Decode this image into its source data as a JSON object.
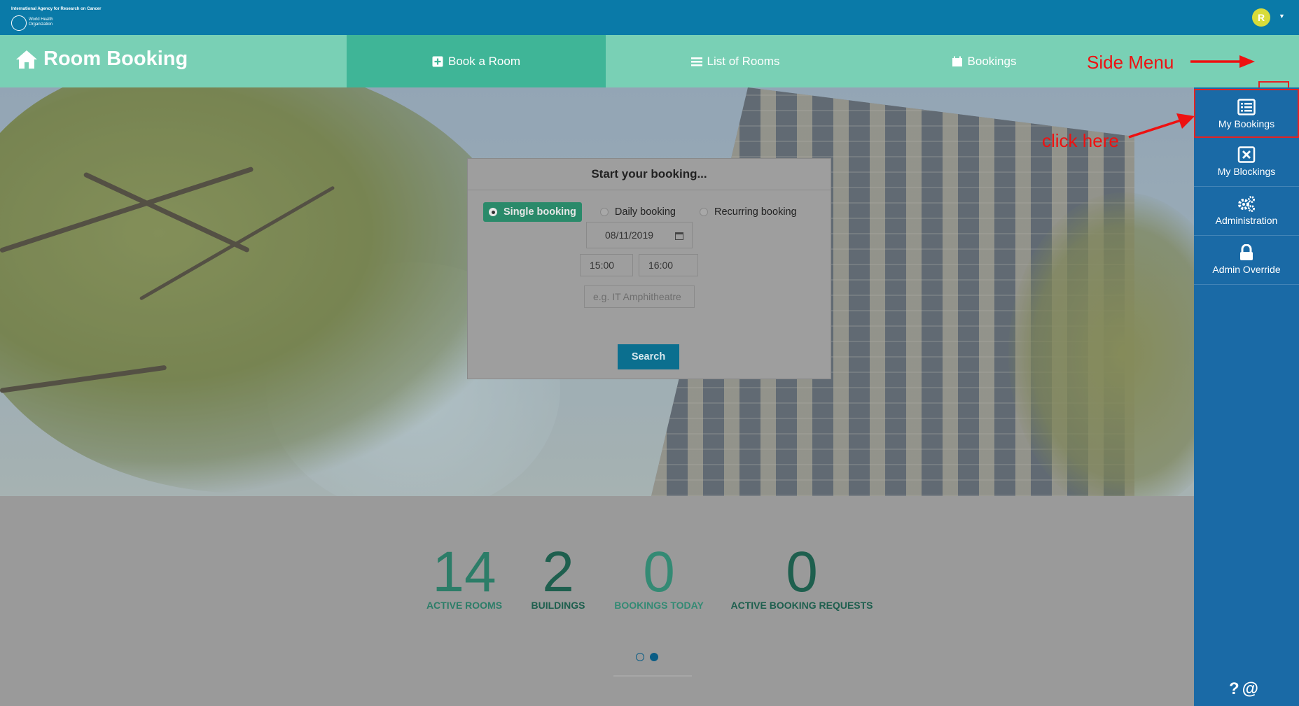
{
  "header": {
    "org_line": "International Agency for Research on Cancer",
    "who_text": "World Health Organization",
    "avatar_initial": "R"
  },
  "navbar": {
    "brand": "Room Booking",
    "items": [
      {
        "label": "Book a Room",
        "icon": "plus-square-icon",
        "active": true
      },
      {
        "label": "List of Rooms",
        "icon": "list-icon",
        "active": false
      },
      {
        "label": "Bookings",
        "icon": "calendar-icon",
        "active": false
      }
    ]
  },
  "annotations": {
    "side_menu": "Side Menu",
    "click_here": "click here"
  },
  "booking_form": {
    "title": "Start your booking...",
    "options": [
      {
        "label": "Single booking",
        "selected": true
      },
      {
        "label": "Daily booking",
        "selected": false
      },
      {
        "label": "Recurring booking",
        "selected": false
      }
    ],
    "date": "08/11/2019",
    "start_time": "15:00",
    "end_time": "16:00",
    "room_placeholder": "e.g. IT Amphitheatre",
    "search_label": "Search"
  },
  "stats": [
    {
      "value": "14",
      "label": "ACTIVE ROOMS",
      "color": "#2c7d68"
    },
    {
      "value": "2",
      "label": "BUILDINGS",
      "color": "#1e5f4e"
    },
    {
      "value": "0",
      "label": "BOOKINGS TODAY",
      "color": "#348a74"
    },
    {
      "value": "0",
      "label": "ACTIVE BOOKING REQUESTS",
      "color": "#1e5f4e"
    }
  ],
  "carousel": {
    "pages": 2,
    "active": 2
  },
  "side_menu": {
    "items": [
      {
        "label": "My Bookings",
        "icon": "list-alt-icon"
      },
      {
        "label": "My Blockings",
        "icon": "x-square-icon"
      },
      {
        "label": "Administration",
        "icon": "cogs-icon"
      },
      {
        "label": "Admin Override",
        "icon": "lock-icon"
      }
    ],
    "footer": "?@"
  },
  "colors": {
    "topbar": "#0a7aa8",
    "navbar": "#79d0b5",
    "nav_active": "#3fb597",
    "sidemenu": "#1a6aa6",
    "annotation": "#ee1111"
  }
}
